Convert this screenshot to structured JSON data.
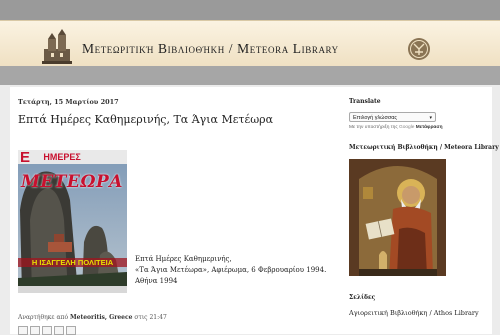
{
  "header": {
    "title": "Μετεωριτική Βιβλιοθήκη / Meteora Library"
  },
  "post": {
    "date": "Τετάρτη, 15 Μαρτίου 2017",
    "title": "Επτά Ημέρες Καθημερινής, Τα Άγια Μετέωρα",
    "cover": {
      "masthead": "ΗΜΕΡΕΣ",
      "masthead_letter": "Ε",
      "title": "ΜΕΤΕΩΡΑ",
      "subtitle": "Η ΙΣΑΓΓΕΛΗ ΠΟΛΙΤΕΙΑ"
    },
    "text_lines": [
      "Επτά Ημέρες Καθημερινής,",
      "«Τα Άγια Μετέωρα», Αφιέρωμα, 6 Φεβρουαρίου 1994.",
      "Αθήνα 1994"
    ],
    "footer": {
      "prefix": "Αναρτήθηκε από",
      "author": "Meteoritis, Greece",
      "time_prefix": "στις",
      "time": "21:47"
    }
  },
  "sidebar": {
    "translate_heading": "Translate",
    "language_select": "Επιλογή γλώσσας",
    "powered_by": "Με την υποστήριξη της",
    "powered_google": "Google",
    "powered_service": "Μετάφραση",
    "library_heading": "Μετεωριτική Βιβλιοθήκη / Meteora Library",
    "links_heading": "Σελίδες",
    "links": [
      "Αγιορειτική Βιβλιοθήκη / Athos Library"
    ]
  },
  "colors": {
    "top_bar": "#9a9a9a",
    "header_bg": "#f3e7cd",
    "cover_red": "#c8102e"
  }
}
